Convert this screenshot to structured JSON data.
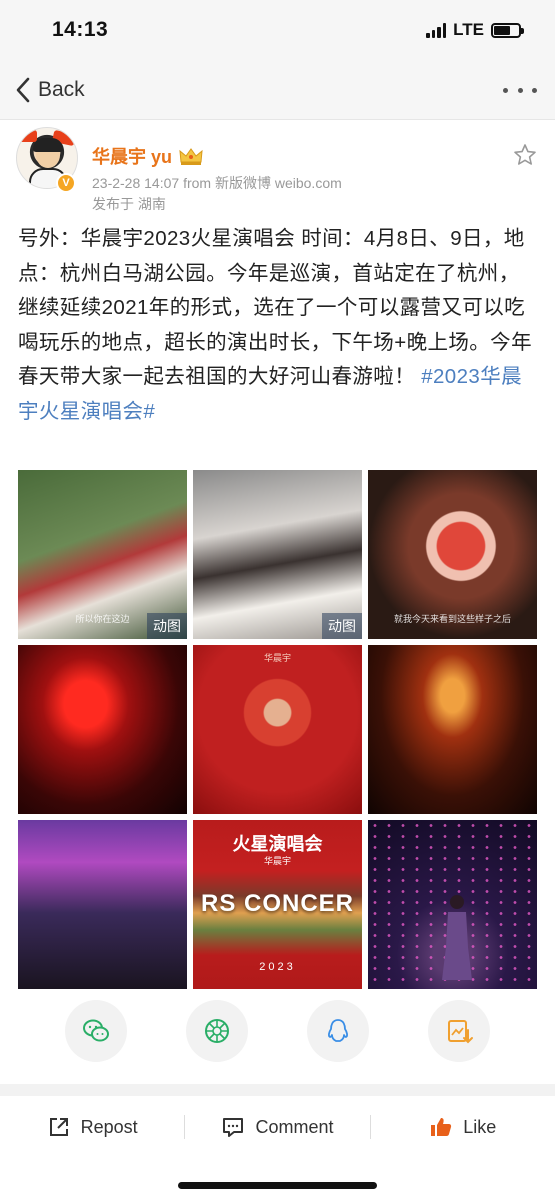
{
  "status_bar": {
    "time": "14:13",
    "network": "LTE",
    "battery_level": 0.6
  },
  "nav": {
    "back_label": "Back",
    "more_icon": "more-dots-icon"
  },
  "post": {
    "username": "华晨宇 yu",
    "verified_badge": "v-icon",
    "meta": "23-2-28 14:07  from 新版微博 weibo.com",
    "location": "发布于 湖南",
    "text_body": "号外：华晨宇2023火星演唱会 时间：4月8日、9日，地点：杭州白马湖公园。今年是巡演，首站定在了杭州，继续延续2021年的形式，选在了一个可以露营又可以吃喝玩乐的地点，超长的演出时长，下午场+晚上场。今年春天带大家一起去祖国的大好河山春游啦！ ",
    "hashtag": "#2023华晨宇火星演唱会#"
  },
  "images": {
    "gif_badge": "动图",
    "tiles": [
      {
        "caption": "所以你在这边"
      },
      {
        "caption": ""
      },
      {
        "caption": "就我今天来看到这些样子之后"
      },
      {
        "caption": ""
      },
      {
        "caption": "华晨宇"
      },
      {
        "caption": ""
      },
      {
        "caption": ""
      },
      {
        "poster_title": "火星演唱会",
        "poster_sub": "华晨宇",
        "poster_mid": "RS CONCER",
        "poster_year": "2023"
      },
      {
        "caption": ""
      }
    ]
  },
  "share": {
    "items": [
      {
        "name": "wechat-icon",
        "color": "#2aae67"
      },
      {
        "name": "moments-icon",
        "color": "#2aae67"
      },
      {
        "name": "qq-icon",
        "color": "#3a8ee6"
      },
      {
        "name": "save-image-icon",
        "color": "#f0a030"
      }
    ]
  },
  "actions": {
    "repost": "Repost",
    "comment": "Comment",
    "like": "Like",
    "like_color": "#e8601a"
  },
  "colors": {
    "username": "#e8741a",
    "hashtag": "#4d7fbf",
    "meta": "#999999"
  }
}
